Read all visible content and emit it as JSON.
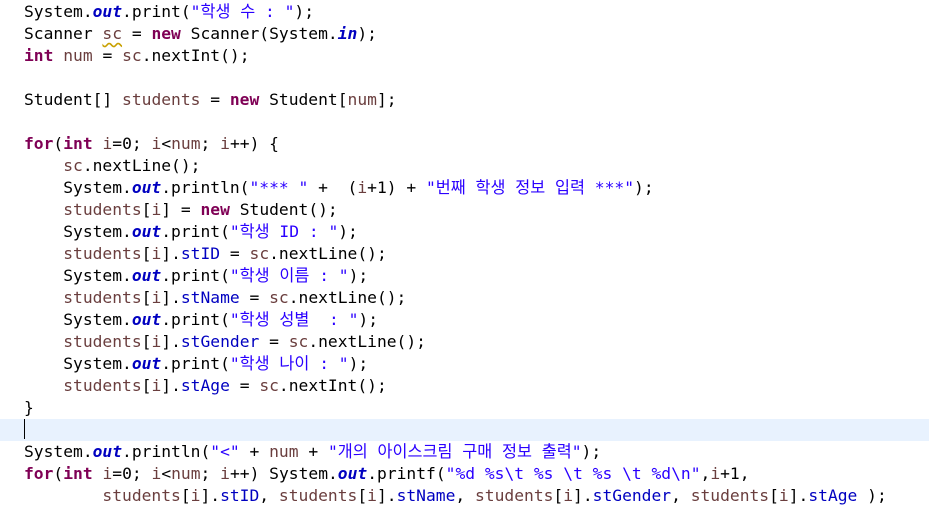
{
  "code_lines": [
    "System.out.print(\"학생 수 : \");",
    "Scanner sc = new Scanner(System.in);",
    "int num = sc.nextInt();",
    "",
    "Student[] students = new Student[num];",
    "",
    "for(int i=0; i<num; i++) {",
    "    sc.nextLine();",
    "    System.out.println(\"*** \" +  (i+1) + \"번째 학생 정보 입력 ***\");",
    "    students[i] = new Student();",
    "    System.out.print(\"학생 ID : \");",
    "    students[i].stID = sc.nextLine();",
    "    System.out.print(\"학생 이름 : \");",
    "    students[i].stName = sc.nextLine();",
    "    System.out.print(\"학생 성별  : \");",
    "    students[i].stGender = sc.nextLine();",
    "    System.out.print(\"학생 나이 : \");",
    "    students[i].stAge = sc.nextInt();",
    "}",
    "",
    "System.out.println(\"<\" + num + \"개의 아이스크림 구매 정보 출력\");",
    "for(int i=0; i<num; i++) System.out.printf(\"%d %s\\t %s \\t %s \\t %d\\n\",i+1,",
    "        students[i].stID, students[i].stName, students[i].stGender, students[i].stAge );"
  ],
  "active_line_index": 19,
  "colors": {
    "keyword": "#7f0055",
    "static_field": "#0000c0",
    "local_variable": "#6a3e3e",
    "string": "#2a00ff",
    "current_line_highlight": "#e8f2fe"
  }
}
